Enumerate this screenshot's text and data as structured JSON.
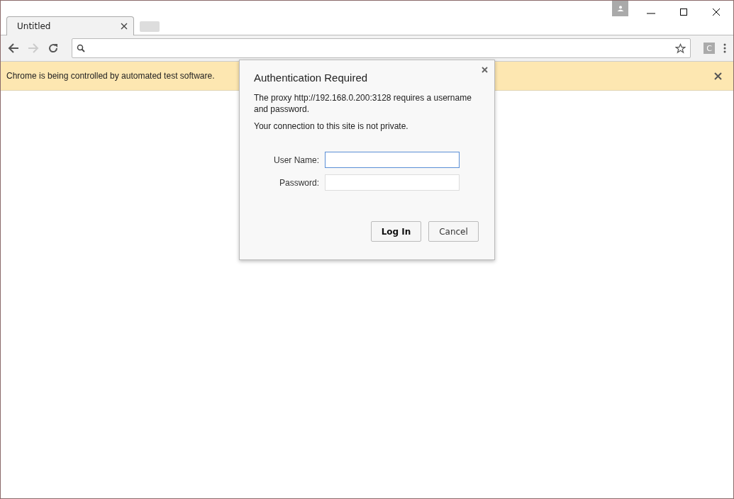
{
  "tabs": [
    {
      "title": "Untitled",
      "selected": true
    }
  ],
  "toolbar": {
    "extension_label": "C"
  },
  "infobar": {
    "message": "Chrome is being controlled by automated test software."
  },
  "dialog": {
    "title": "Authentication Required",
    "message": "The proxy http://192.168.0.200:3128 requires a username and password.",
    "note": "Your connection to this site is not private.",
    "fields": [
      {
        "label": "User Name:",
        "focused": true
      },
      {
        "label": "Password:",
        "focused": false
      }
    ],
    "buttons": [
      {
        "label": "Log In",
        "default": true
      },
      {
        "label": "Cancel",
        "default": false
      }
    ]
  }
}
